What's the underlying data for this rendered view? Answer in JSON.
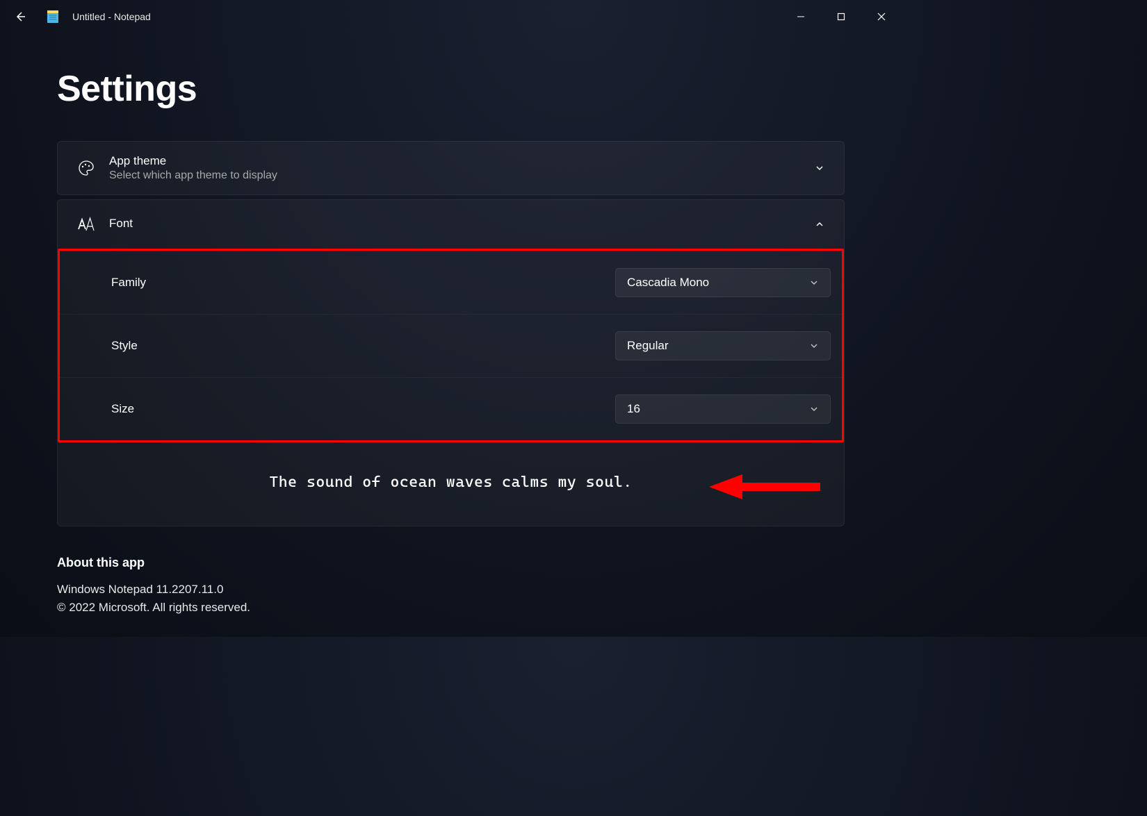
{
  "window": {
    "title": "Untitled - Notepad"
  },
  "page": {
    "heading": "Settings"
  },
  "appTheme": {
    "title": "App theme",
    "subtitle": "Select which app theme to display"
  },
  "font": {
    "title": "Font",
    "family": {
      "label": "Family",
      "value": "Cascadia Mono"
    },
    "style": {
      "label": "Style",
      "value": "Regular"
    },
    "size": {
      "label": "Size",
      "value": "16"
    },
    "preview": "The sound of ocean waves calms my soul."
  },
  "about": {
    "heading": "About this app",
    "version": "Windows Notepad 11.2207.11.0",
    "copyright": "© 2022 Microsoft. All rights reserved."
  }
}
